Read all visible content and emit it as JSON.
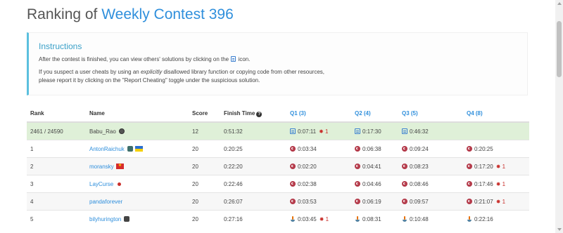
{
  "page": {
    "title_prefix": "Ranking of ",
    "title_contest": "Weekly Contest 396"
  },
  "instructions": {
    "title": "Instructions",
    "line1_before": "After the contest is finished, you can view others' solutions by clicking on the ",
    "line1_after": " icon.",
    "line2_before": "If you suspect a user cheats by using an ",
    "line2_em": "explicitly",
    "line2_after": " disallowed library function or copying code from other resources,",
    "line3": "please report it by clicking on the \"Report Cheating\" toggle under the suspicious solution."
  },
  "table": {
    "headers": {
      "rank": "Rank",
      "name": "Name",
      "score": "Score",
      "finish_time": "Finish Time",
      "q1": "Q1 (3)",
      "q2": "Q2 (4)",
      "q3": "Q3 (5)",
      "q4": "Q4 (8)"
    },
    "rows": [
      {
        "rank": "2461 / 24590",
        "name": "Babu_Rao",
        "score": "12",
        "finish": "0:51:32",
        "q1": "0:07:11",
        "q1_bugs": "1",
        "q2": "0:17:30",
        "q3": "0:46:32",
        "q4": ""
      },
      {
        "rank": "1",
        "name": "AntonRaichuk",
        "score": "20",
        "finish": "0:20:25",
        "q1": "0:03:34",
        "q2": "0:06:38",
        "q3": "0:09:24",
        "q4": "0:20:25"
      },
      {
        "rank": "2",
        "name": "moransky",
        "score": "20",
        "finish": "0:22:20",
        "q1": "0:02:20",
        "q2": "0:04:41",
        "q3": "0:08:23",
        "q4": "0:17:20",
        "q4_bugs": "1"
      },
      {
        "rank": "3",
        "name": "LayCurse",
        "score": "20",
        "finish": "0:22:46",
        "q1": "0:02:38",
        "q2": "0:04:46",
        "q3": "0:08:46",
        "q4": "0:17:46",
        "q4_bugs": "1"
      },
      {
        "rank": "4",
        "name": "pandaforever",
        "score": "20",
        "finish": "0:26:07",
        "q1": "0:03:53",
        "q2": "0:06:19",
        "q3": "0:09:57",
        "q4": "0:21:07",
        "q4_bugs": "1"
      },
      {
        "rank": "5",
        "name": "bilyhurington",
        "score": "20",
        "finish": "0:27:16",
        "q1": "0:03:45",
        "q1_bugs": "1",
        "q2": "0:08:31",
        "q3": "0:10:48",
        "q4": "0:22:16"
      }
    ]
  },
  "colors": {
    "accent": "#2f8fdc",
    "instructions_border": "#5bc0de",
    "self_row": "#dff0d8",
    "bug": "#c9302c"
  }
}
